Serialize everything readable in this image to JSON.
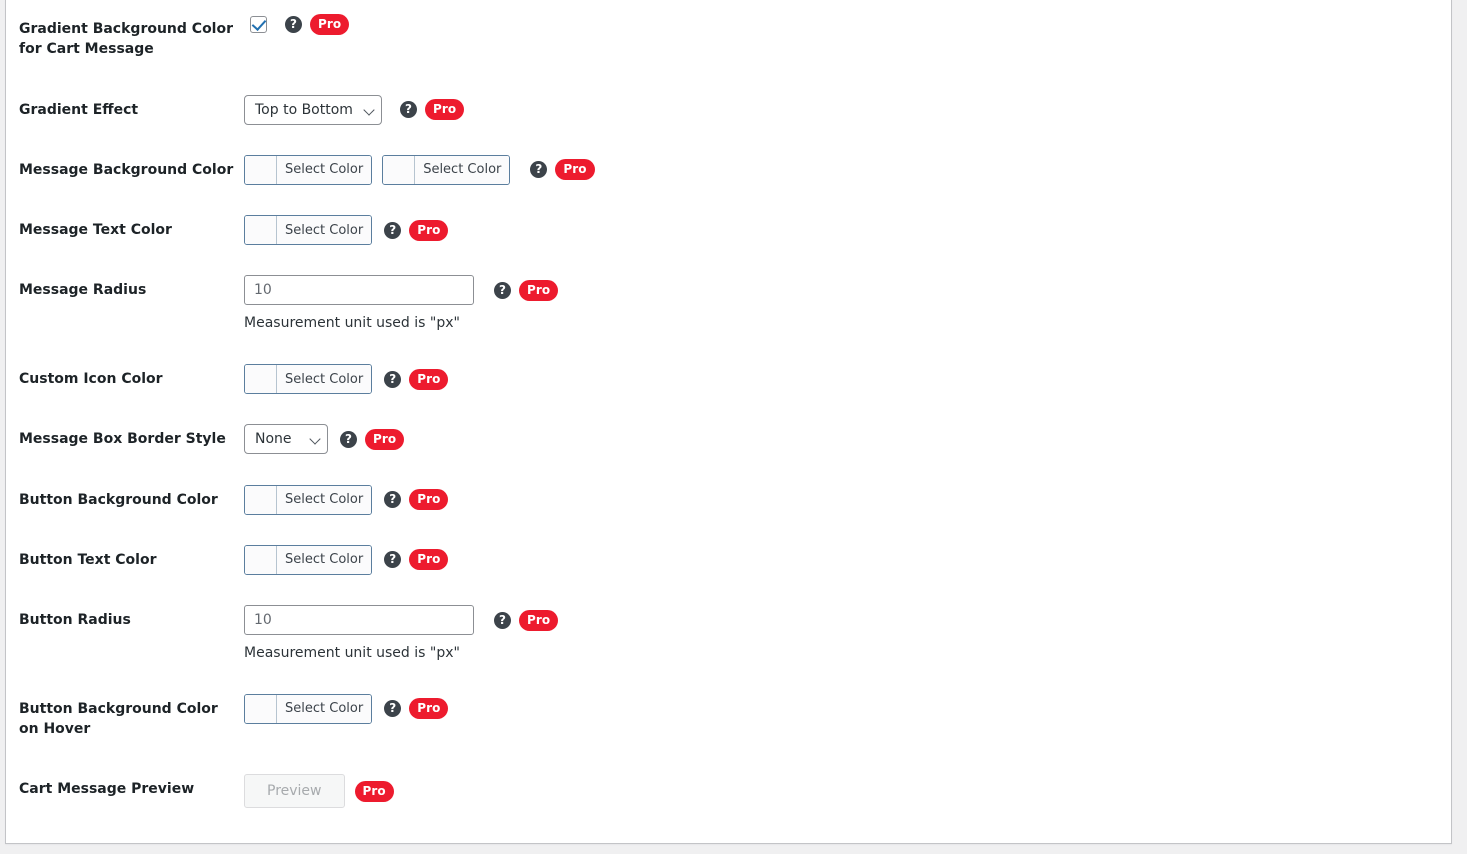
{
  "common": {
    "pro_badge": "Pro",
    "help_icon_glyph": "?",
    "select_color_label": "Select Color",
    "measurement_note": "Measurement unit used is \"px\"",
    "accent_pro": "#ed1b2e",
    "checkbox_check_color": "#2271b1",
    "color_picker_border": "#5b7e9e"
  },
  "rows": [
    {
      "label": "Gradient Background Color for Cart Message",
      "control": "checkbox",
      "checked": true
    },
    {
      "label": "Gradient Effect",
      "control": "select",
      "value": "Top to Bottom"
    },
    {
      "label": "Message Background Color",
      "control": "color-pair",
      "swatch_label_1": "Select Color",
      "swatch_label_2": "Select Color"
    },
    {
      "label": "Message Text Color",
      "control": "color",
      "swatch_label": "Select Color"
    },
    {
      "label": "Message Radius",
      "control": "text",
      "placeholder": "10",
      "description": "Measurement unit used is \"px\""
    },
    {
      "label": "Custom Icon Color",
      "control": "color",
      "swatch_label": "Select Color"
    },
    {
      "label": "Message Box Border Style",
      "control": "select",
      "value": "None"
    },
    {
      "label": "Button Background Color",
      "control": "color",
      "swatch_label": "Select Color"
    },
    {
      "label": "Button Text Color",
      "control": "color",
      "swatch_label": "Select Color"
    },
    {
      "label": "Button Radius",
      "control": "text",
      "placeholder": "10",
      "description": "Measurement unit used is \"px\""
    },
    {
      "label": "Button Background Color on Hover",
      "control": "color",
      "swatch_label": "Select Color"
    },
    {
      "label": "Cart Message Preview",
      "control": "button",
      "button_label": "Preview"
    }
  ]
}
